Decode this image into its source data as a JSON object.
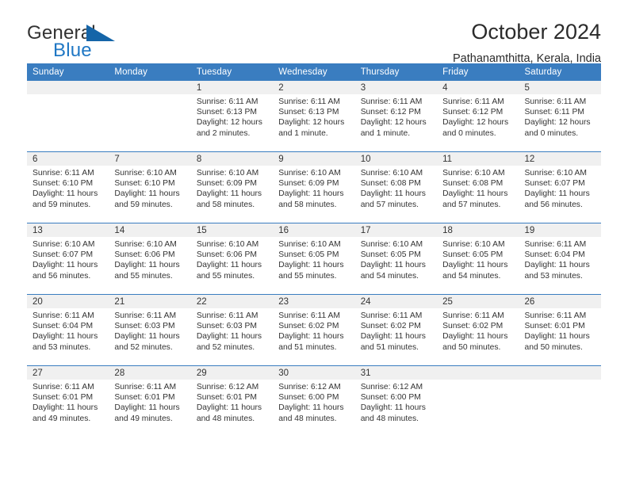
{
  "brand": {
    "name_part1": "General",
    "name_part2": "Blue",
    "logo_icon": "triangle-logo-icon",
    "accent_color": "#1f77c4"
  },
  "header": {
    "title": "October 2024",
    "location": "Pathanamthitta, Kerala, India"
  },
  "calendar": {
    "header_bg": "#3a7dc0",
    "daynum_bg": "#f0f0f0",
    "weekdays": [
      "Sunday",
      "Monday",
      "Tuesday",
      "Wednesday",
      "Thursday",
      "Friday",
      "Saturday"
    ],
    "weeks": [
      [
        {
          "day": "",
          "sunrise": "",
          "sunset": "",
          "daylight": ""
        },
        {
          "day": "",
          "sunrise": "",
          "sunset": "",
          "daylight": ""
        },
        {
          "day": "1",
          "sunrise": "Sunrise: 6:11 AM",
          "sunset": "Sunset: 6:13 PM",
          "daylight": "Daylight: 12 hours and 2 minutes."
        },
        {
          "day": "2",
          "sunrise": "Sunrise: 6:11 AM",
          "sunset": "Sunset: 6:13 PM",
          "daylight": "Daylight: 12 hours and 1 minute."
        },
        {
          "day": "3",
          "sunrise": "Sunrise: 6:11 AM",
          "sunset": "Sunset: 6:12 PM",
          "daylight": "Daylight: 12 hours and 1 minute."
        },
        {
          "day": "4",
          "sunrise": "Sunrise: 6:11 AM",
          "sunset": "Sunset: 6:12 PM",
          "daylight": "Daylight: 12 hours and 0 minutes."
        },
        {
          "day": "5",
          "sunrise": "Sunrise: 6:11 AM",
          "sunset": "Sunset: 6:11 PM",
          "daylight": "Daylight: 12 hours and 0 minutes."
        }
      ],
      [
        {
          "day": "6",
          "sunrise": "Sunrise: 6:11 AM",
          "sunset": "Sunset: 6:10 PM",
          "daylight": "Daylight: 11 hours and 59 minutes."
        },
        {
          "day": "7",
          "sunrise": "Sunrise: 6:10 AM",
          "sunset": "Sunset: 6:10 PM",
          "daylight": "Daylight: 11 hours and 59 minutes."
        },
        {
          "day": "8",
          "sunrise": "Sunrise: 6:10 AM",
          "sunset": "Sunset: 6:09 PM",
          "daylight": "Daylight: 11 hours and 58 minutes."
        },
        {
          "day": "9",
          "sunrise": "Sunrise: 6:10 AM",
          "sunset": "Sunset: 6:09 PM",
          "daylight": "Daylight: 11 hours and 58 minutes."
        },
        {
          "day": "10",
          "sunrise": "Sunrise: 6:10 AM",
          "sunset": "Sunset: 6:08 PM",
          "daylight": "Daylight: 11 hours and 57 minutes."
        },
        {
          "day": "11",
          "sunrise": "Sunrise: 6:10 AM",
          "sunset": "Sunset: 6:08 PM",
          "daylight": "Daylight: 11 hours and 57 minutes."
        },
        {
          "day": "12",
          "sunrise": "Sunrise: 6:10 AM",
          "sunset": "Sunset: 6:07 PM",
          "daylight": "Daylight: 11 hours and 56 minutes."
        }
      ],
      [
        {
          "day": "13",
          "sunrise": "Sunrise: 6:10 AM",
          "sunset": "Sunset: 6:07 PM",
          "daylight": "Daylight: 11 hours and 56 minutes."
        },
        {
          "day": "14",
          "sunrise": "Sunrise: 6:10 AM",
          "sunset": "Sunset: 6:06 PM",
          "daylight": "Daylight: 11 hours and 55 minutes."
        },
        {
          "day": "15",
          "sunrise": "Sunrise: 6:10 AM",
          "sunset": "Sunset: 6:06 PM",
          "daylight": "Daylight: 11 hours and 55 minutes."
        },
        {
          "day": "16",
          "sunrise": "Sunrise: 6:10 AM",
          "sunset": "Sunset: 6:05 PM",
          "daylight": "Daylight: 11 hours and 55 minutes."
        },
        {
          "day": "17",
          "sunrise": "Sunrise: 6:10 AM",
          "sunset": "Sunset: 6:05 PM",
          "daylight": "Daylight: 11 hours and 54 minutes."
        },
        {
          "day": "18",
          "sunrise": "Sunrise: 6:10 AM",
          "sunset": "Sunset: 6:05 PM",
          "daylight": "Daylight: 11 hours and 54 minutes."
        },
        {
          "day": "19",
          "sunrise": "Sunrise: 6:11 AM",
          "sunset": "Sunset: 6:04 PM",
          "daylight": "Daylight: 11 hours and 53 minutes."
        }
      ],
      [
        {
          "day": "20",
          "sunrise": "Sunrise: 6:11 AM",
          "sunset": "Sunset: 6:04 PM",
          "daylight": "Daylight: 11 hours and 53 minutes."
        },
        {
          "day": "21",
          "sunrise": "Sunrise: 6:11 AM",
          "sunset": "Sunset: 6:03 PM",
          "daylight": "Daylight: 11 hours and 52 minutes."
        },
        {
          "day": "22",
          "sunrise": "Sunrise: 6:11 AM",
          "sunset": "Sunset: 6:03 PM",
          "daylight": "Daylight: 11 hours and 52 minutes."
        },
        {
          "day": "23",
          "sunrise": "Sunrise: 6:11 AM",
          "sunset": "Sunset: 6:02 PM",
          "daylight": "Daylight: 11 hours and 51 minutes."
        },
        {
          "day": "24",
          "sunrise": "Sunrise: 6:11 AM",
          "sunset": "Sunset: 6:02 PM",
          "daylight": "Daylight: 11 hours and 51 minutes."
        },
        {
          "day": "25",
          "sunrise": "Sunrise: 6:11 AM",
          "sunset": "Sunset: 6:02 PM",
          "daylight": "Daylight: 11 hours and 50 minutes."
        },
        {
          "day": "26",
          "sunrise": "Sunrise: 6:11 AM",
          "sunset": "Sunset: 6:01 PM",
          "daylight": "Daylight: 11 hours and 50 minutes."
        }
      ],
      [
        {
          "day": "27",
          "sunrise": "Sunrise: 6:11 AM",
          "sunset": "Sunset: 6:01 PM",
          "daylight": "Daylight: 11 hours and 49 minutes."
        },
        {
          "day": "28",
          "sunrise": "Sunrise: 6:11 AM",
          "sunset": "Sunset: 6:01 PM",
          "daylight": "Daylight: 11 hours and 49 minutes."
        },
        {
          "day": "29",
          "sunrise": "Sunrise: 6:12 AM",
          "sunset": "Sunset: 6:01 PM",
          "daylight": "Daylight: 11 hours and 48 minutes."
        },
        {
          "day": "30",
          "sunrise": "Sunrise: 6:12 AM",
          "sunset": "Sunset: 6:00 PM",
          "daylight": "Daylight: 11 hours and 48 minutes."
        },
        {
          "day": "31",
          "sunrise": "Sunrise: 6:12 AM",
          "sunset": "Sunset: 6:00 PM",
          "daylight": "Daylight: 11 hours and 48 minutes."
        },
        {
          "day": "",
          "sunrise": "",
          "sunset": "",
          "daylight": ""
        },
        {
          "day": "",
          "sunrise": "",
          "sunset": "",
          "daylight": ""
        }
      ]
    ]
  }
}
